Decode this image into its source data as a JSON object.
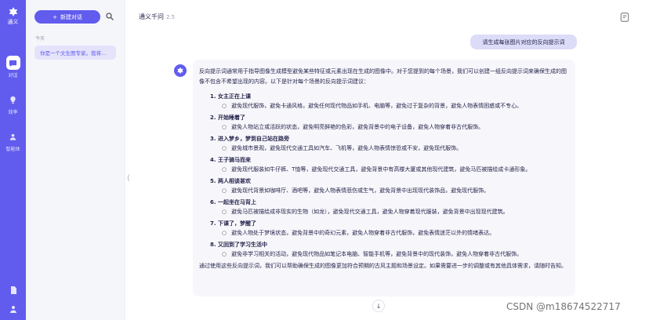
{
  "app": {
    "name": "通义",
    "accent_color": "#615ced"
  },
  "rail": {
    "items": [
      {
        "label": "对话",
        "icon": "chat-icon",
        "active": true
      },
      {
        "label": "效率",
        "icon": "lightbulb-icon",
        "active": false
      },
      {
        "label": "智能体",
        "icon": "agent-icon",
        "active": false
      }
    ]
  },
  "sidebar": {
    "new_chat_label": "新建对话",
    "section_label": "今天",
    "history": [
      {
        "label": "你是一个文生图专家。我将…"
      }
    ]
  },
  "header": {
    "model_name": "通义千问",
    "model_version": "2.5"
  },
  "conversation": {
    "user_message": "请生成每张图片对应的反向提示词",
    "intro": "反向提示词通常用于指导图像生成模型避免某些特征或元素出现在生成的图像中。对于您提到的每个场景，我们可以创建一组反向提示词来确保生成的图像不包含不希望出现的内容。以下是针对每个场景的反向提示词建议：",
    "scenes": [
      {
        "title": "1. 女主正在上课",
        "detail": "避免现代服饰，避免卡通风格，避免任何现代物品如手机、电脑等，避免过于复杂的背景，避免人物表情困惑或不专心。"
      },
      {
        "title": "2. 开始睡着了",
        "detail": "避免人物站立或活跃的状态，避免明亮鲜艳的色彩，避免背景中的电子设备，避免人物穿着非古代服饰。"
      },
      {
        "title": "3. 进入梦乡，梦到自己站在路旁",
        "detail": "避免城市景观，避免现代交通工具如汽车、飞机等，避免人物表情惊恐或不安，避免现代服饰。"
      },
      {
        "title": "4. 王子骑马而来",
        "detail": "避免现代服装如牛仔裤、T恤等，避免现代交通工具，避免背景中有高楼大厦或其他现代建筑，避免马匹被描绘成卡通形象。"
      },
      {
        "title": "5. 两人相谈甚欢",
        "detail": "避免现代背景如咖啡厅、酒吧等，避免人物表情悲伤或生气，避免背景中出现现代装饰品，避免现代服饰。"
      },
      {
        "title": "6. 一起坐在马背上",
        "detail": "避免马匹被描绘成非现实的生物（如龙），避免现代交通工具，避免人物穿着现代服装，避免背景中出现现代建筑。"
      },
      {
        "title": "7. 下课了，梦醒了",
        "detail": "避免人物处于梦境状态，避免背景中的奇幻元素，避免人物穿着非古代服饰，避免表情迷茫以外的情绪表达。"
      },
      {
        "title": "8. 又回到了学习生活中",
        "detail": "避免非学习相关的活动，避免现代物品如笔记本电脑、智能手机等，避免背景中的现代装饰，避免人物穿着非古代服饰。"
      }
    ],
    "outro": "通过使用这些反向提示词，我们可以帮助确保生成的图像更加符合预期的古风主题和场景设定。如果需要进一步的调整或有其他具体需求，请随时告知。"
  },
  "watermark": "CSDN @m18674522717"
}
